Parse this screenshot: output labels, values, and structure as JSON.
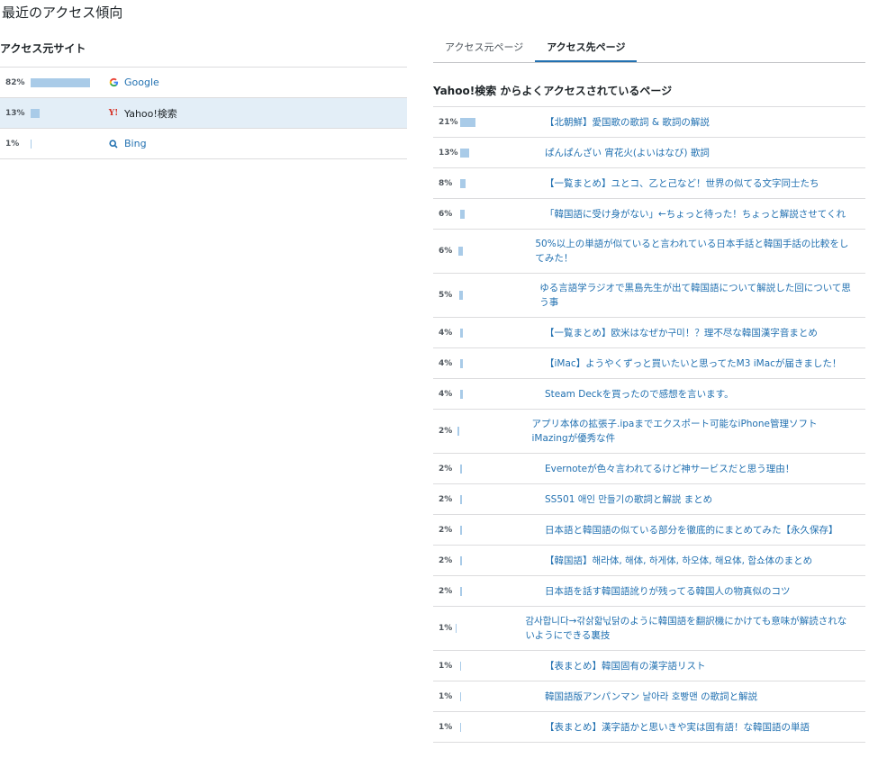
{
  "page": {
    "title": "最近のアクセス傾向"
  },
  "sources": {
    "title": "アクセス元サイト",
    "items": [
      {
        "percent": "82%",
        "fraction": 0.82,
        "label": "Google",
        "icon": "google-icon",
        "selected": false
      },
      {
        "percent": "13%",
        "fraction": 0.13,
        "label": "Yahoo!検索",
        "icon": "yahoo-icon",
        "selected": true
      },
      {
        "percent": "1%",
        "fraction": 0.01,
        "label": "Bing",
        "icon": "search-icon",
        "selected": false
      }
    ]
  },
  "tabs": [
    {
      "label": "アクセス元ページ",
      "active": false
    },
    {
      "label": "アクセス先ページ",
      "active": true
    }
  ],
  "destination": {
    "title": "Yahoo!検索 からよくアクセスされているページ",
    "items": [
      {
        "percent": "21%",
        "fraction": 0.21,
        "label": "【北朝鮮】愛国歌の歌詞 & 歌詞の解説"
      },
      {
        "percent": "13%",
        "fraction": 0.13,
        "label": "ぱんぱんざい 宵花火(よいはなび) 歌詞"
      },
      {
        "percent": "8%",
        "fraction": 0.08,
        "label": "【一覧まとめ】ユとコ、乙と己など！世界の似てる文字同士たち"
      },
      {
        "percent": "6%",
        "fraction": 0.06,
        "label": "「韓国語に受け身がない」←ちょっと待った！ちょっと解説させてくれ"
      },
      {
        "percent": "6%",
        "fraction": 0.06,
        "label": "50%以上の単語が似ていると言われている日本手話と韓国手話の比較をしてみた！"
      },
      {
        "percent": "5%",
        "fraction": 0.05,
        "label": "ゆる言語学ラジオで黒島先生が出て韓国語について解説した回について思う事"
      },
      {
        "percent": "4%",
        "fraction": 0.04,
        "label": "【一覧まとめ】欧米はなぜか구미！？理不尽な韓国漢字音まとめ"
      },
      {
        "percent": "4%",
        "fraction": 0.04,
        "label": "【iMac】ようやくずっと買いたいと思ってたM3 iMacが届きました！"
      },
      {
        "percent": "4%",
        "fraction": 0.04,
        "label": "Steam Deckを買ったので感想を言います。"
      },
      {
        "percent": "2%",
        "fraction": 0.02,
        "label": "アプリ本体の拡張子.ipaまでエクスポート可能なiPhone管理ソフトiMazingが優秀な件"
      },
      {
        "percent": "2%",
        "fraction": 0.02,
        "label": "Evernoteが色々言われてるけど神サービスだと思う理由！"
      },
      {
        "percent": "2%",
        "fraction": 0.02,
        "label": "SS501 애인 만들기の歌詞と解説 まとめ"
      },
      {
        "percent": "2%",
        "fraction": 0.02,
        "label": "日本語と韓国語の似ている部分を徹底的にまとめてみた【永久保存】"
      },
      {
        "percent": "2%",
        "fraction": 0.02,
        "label": "【韓国語】해라体, 해体, 하게体, 하오体, 해요体, 합쇼体のまとめ"
      },
      {
        "percent": "2%",
        "fraction": 0.02,
        "label": "日本語を話す韓国語訛りが残ってる韓国人の物真似のコツ"
      },
      {
        "percent": "1%",
        "fraction": 0.01,
        "label": "감사합니다→갂삵핣닋닭のように韓国語を翻訳機にかけても意味が解読されないようにできる裏技"
      },
      {
        "percent": "1%",
        "fraction": 0.01,
        "label": "【表まとめ】韓国固有の漢字語リスト"
      },
      {
        "percent": "1%",
        "fraction": 0.01,
        "label": "韓国語版アンパンマン 날아라 호빵맨 の歌詞と解説"
      },
      {
        "percent": "1%",
        "fraction": 0.01,
        "label": "【表まとめ】漢字語かと思いきや実は固有語！な韓国語の単語"
      }
    ]
  },
  "colors": {
    "bar": "#a9cbe8",
    "link": "#2271b1",
    "selected_row": "#e3eef7"
  }
}
